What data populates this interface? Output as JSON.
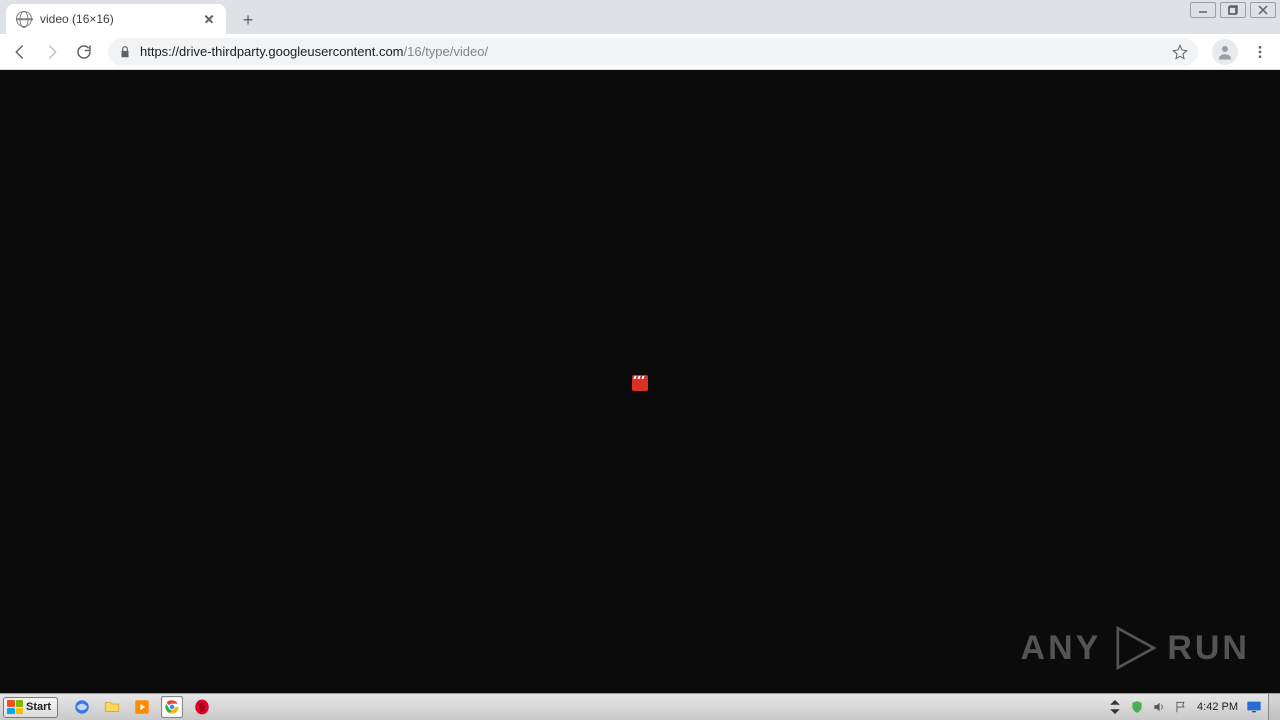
{
  "browser": {
    "tab_title": "video (16×16)",
    "url_scheme_host": "https://drive-thirdparty.googleusercontent.com",
    "url_path": "/16/type/video/",
    "new_tab_tooltip": "New tab"
  },
  "window_controls": {
    "minimize": "Minimize",
    "maximize": "Maximize",
    "close": "Close"
  },
  "content": {
    "icon_name": "video"
  },
  "watermark": {
    "left": "ANY",
    "right": "RUN"
  },
  "taskbar": {
    "start_label": "Start",
    "clock": "4:42 PM"
  }
}
